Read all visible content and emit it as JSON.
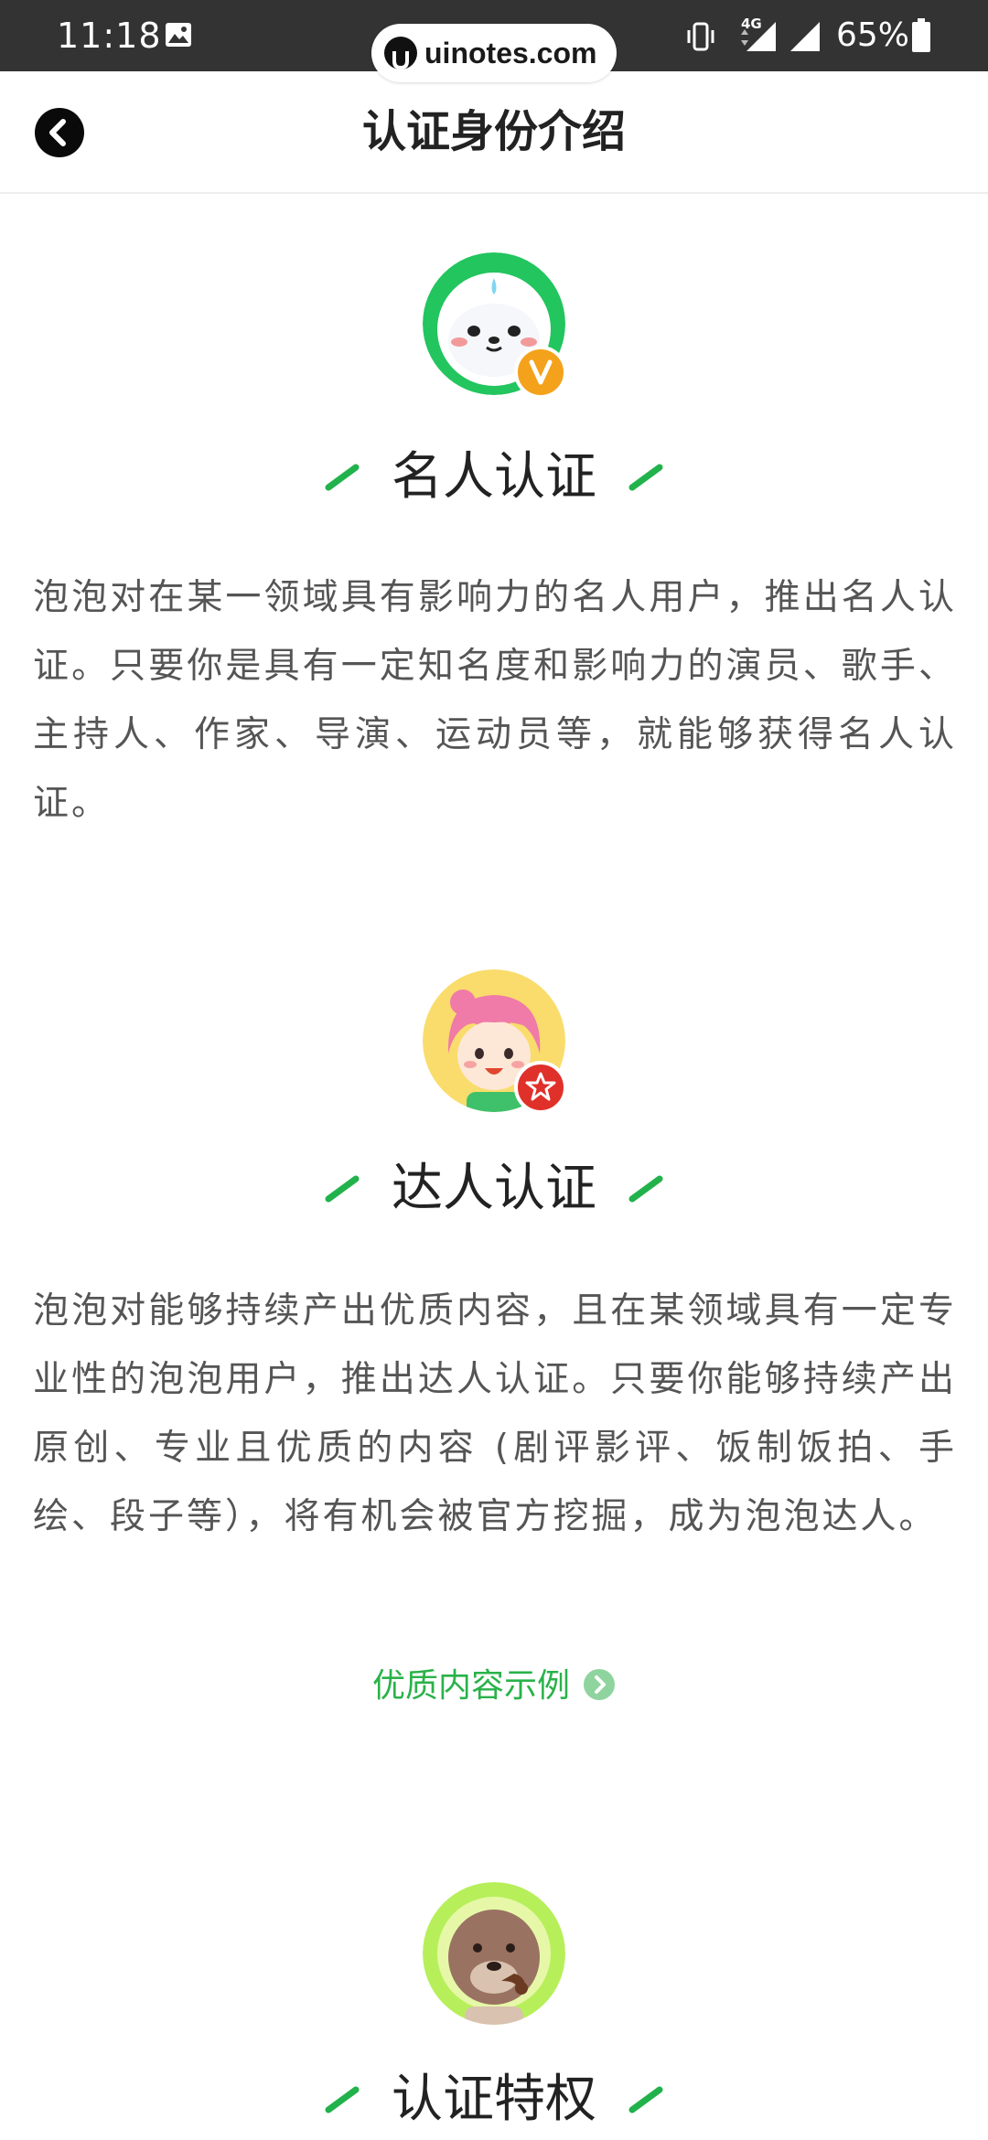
{
  "status_bar": {
    "time": "11:18",
    "network": "4G",
    "battery": "65%"
  },
  "watermark": {
    "text": "uinotes.com"
  },
  "nav": {
    "title": "认证身份介绍"
  },
  "sections": [
    {
      "heading": "名人认证",
      "body": "泡泡对在某一领域具有影响力的名人用户，推出名人认证。只要你是具有一定知名度和影响力的演员、歌手、主持人、作家、导演、运动员等，就能够获得名人认证。",
      "avatar": "seal-mascot-avatar",
      "avatar_ring_color": "#22c55e",
      "badge": "v-badge-icon",
      "badge_label": "V",
      "badge_color": "#f4a21b"
    },
    {
      "heading": "达人认证",
      "body": "泡泡对能够持续产出优质内容，且在某领域具有一定专业性的泡泡用户，推出达人认证。只要你能够持续产出原创、专业且优质的内容 (剧评影评、饭制饭拍、手绘、段子等），将有机会被官方挖掘，成为泡泡达人。",
      "avatar": "pink-hair-girl-avatar",
      "avatar_ring_color": "#f9dc6b",
      "badge": "star-badge-icon",
      "badge_color": "#e0302a",
      "link_label": "优质内容示例"
    },
    {
      "heading": "认证特权",
      "avatar": "otter-pipe-avatar",
      "avatar_ring_color": "#b7ef5a"
    }
  ],
  "colors": {
    "accent_green": "#2ab24a",
    "heading_stroke": "#22b24c",
    "body_text": "#555555"
  }
}
